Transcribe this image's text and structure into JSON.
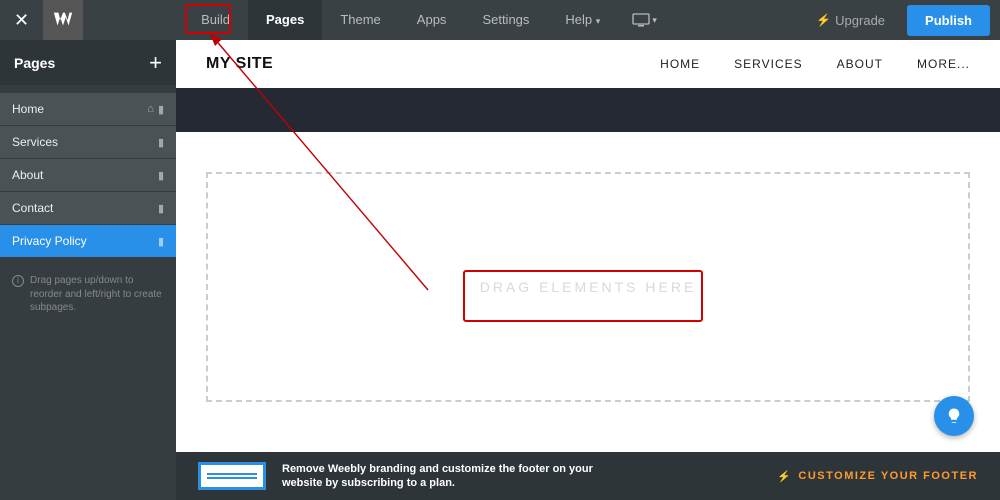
{
  "topbar": {
    "tabs": [
      "Build",
      "Pages",
      "Theme",
      "Apps",
      "Settings",
      "Help"
    ],
    "active_tab": "Pages",
    "upgrade_label": "Upgrade",
    "publish_label": "Publish"
  },
  "sidebar": {
    "title": "Pages",
    "items": [
      {
        "label": "Home",
        "selected": false,
        "has_home_icon": true
      },
      {
        "label": "Services",
        "selected": false,
        "has_home_icon": false
      },
      {
        "label": "About",
        "selected": false,
        "has_home_icon": false
      },
      {
        "label": "Contact",
        "selected": false,
        "has_home_icon": false
      },
      {
        "label": "Privacy Policy",
        "selected": true,
        "has_home_icon": false
      }
    ],
    "hint": "Drag pages up/down to reorder and left/right to create subpages."
  },
  "site": {
    "title": "MY SITE",
    "nav": [
      "HOME",
      "SERVICES",
      "ABOUT",
      "MORE..."
    ],
    "drop_label": "DRAG ELEMENTS HERE"
  },
  "footer": {
    "text_line1": "Remove Weebly branding and customize the footer on your",
    "text_line2": "website by subscribing to a plan.",
    "cta": "CUSTOMIZE YOUR FOOTER"
  },
  "annotations": {
    "highlight_build": true,
    "highlight_drop": true
  }
}
